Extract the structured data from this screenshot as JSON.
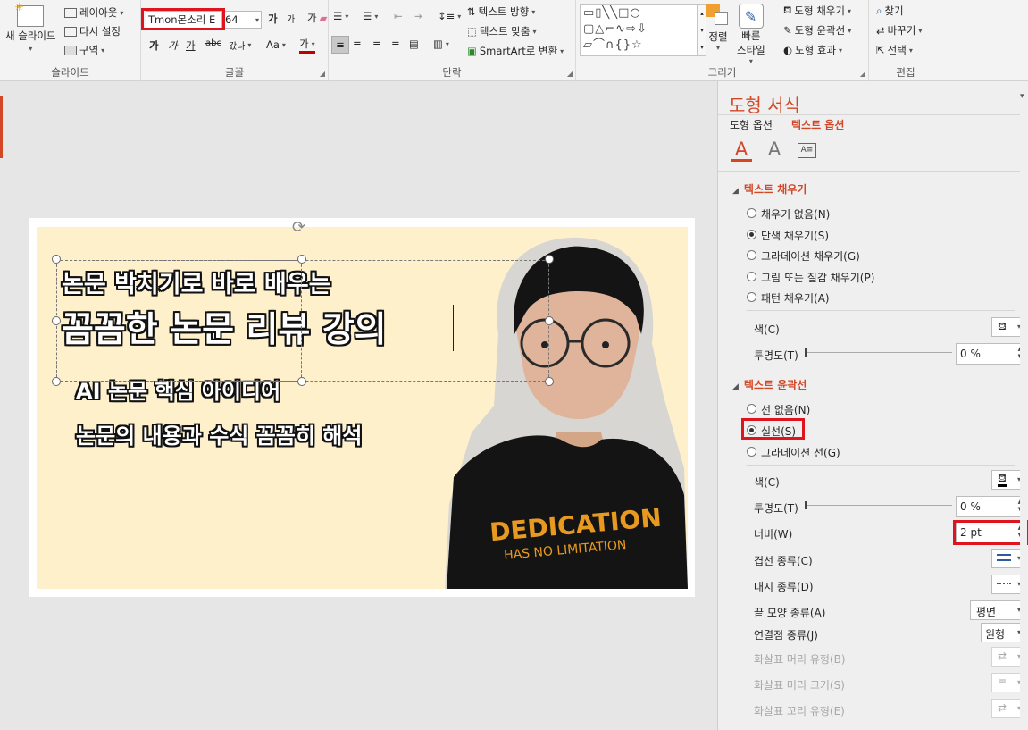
{
  "ribbon": {
    "slides": {
      "new_slide": "새 슬라이드",
      "layout": "레이아웃",
      "reset": "다시 설정",
      "section": "구역",
      "group": "슬라이드"
    },
    "font": {
      "name": "Tmon몬소리 E",
      "size": "64",
      "grow": "가",
      "shrink": "가",
      "clear": "가",
      "bold": "가",
      "italic": "가",
      "underline": "가",
      "strike": "abc",
      "spacing": "갔나",
      "case": "Aa",
      "color": "가",
      "group": "글꼴"
    },
    "paragraph": {
      "text_direction": "텍스트 방향",
      "align_text": "텍스트 맞춤",
      "smartart": "SmartArt로 변환",
      "group": "단락"
    },
    "drawing": {
      "arrange": "정렬",
      "quick_styles_1": "빠른",
      "quick_styles_2": "스타일",
      "shape_fill": "도형 채우기",
      "shape_outline": "도형 윤곽선",
      "shape_effects": "도형 효과",
      "group": "그리기"
    },
    "editing": {
      "find": "찾기",
      "replace": "바꾸기",
      "select": "선택",
      "group": "편집"
    }
  },
  "slide": {
    "line1": "논문 박치기로 바로 배우는",
    "line2": "꼼꼼한 논문 리뷰 강의",
    "line3": "AI 논문 핵심 아이디어",
    "line4": "논문의 내용과 수식 꼼꼼히 해석",
    "shirt1": "DEDICATION",
    "shirt2": "HAS NO LIMITATION"
  },
  "pane": {
    "title": "도형 서식",
    "tab_shape": "도형 옵션",
    "tab_text": "텍스트 옵션",
    "text_fill": {
      "header": "텍스트 채우기",
      "options": [
        "채우기 없음(N)",
        "단색 채우기(S)",
        "그라데이션 채우기(G)",
        "그림 또는 질감 채우기(P)",
        "패턴 채우기(A)"
      ],
      "selected": 1,
      "color_label": "색(C)",
      "transparency_label": "투명도(T)",
      "transparency_value": "0 %"
    },
    "text_outline": {
      "header": "텍스트 윤곽선",
      "options": [
        "선 없음(N)",
        "실선(S)",
        "그라데이션 선(G)"
      ],
      "selected": 1,
      "color_label": "색(C)",
      "transparency_label": "투명도(T)",
      "transparency_value": "0 %",
      "width_label": "너비(W)",
      "width_value": "2 pt",
      "compound_label": "겹선 종류(C)",
      "dash_label": "대시 종류(D)",
      "cap_label": "끝 모양 종류(A)",
      "cap_value": "평면",
      "join_label": "연결점 종류(J)",
      "join_value": "원형",
      "arrow_begin_type": "화살표 머리 유형(B)",
      "arrow_begin_size": "화살표 머리 크기(S)",
      "arrow_end_type": "화살표 꼬리 유형(E)"
    }
  },
  "colors": {
    "accent": "#d24726",
    "highlight": "#e0141e",
    "slide_bg": "#fff0cc"
  }
}
